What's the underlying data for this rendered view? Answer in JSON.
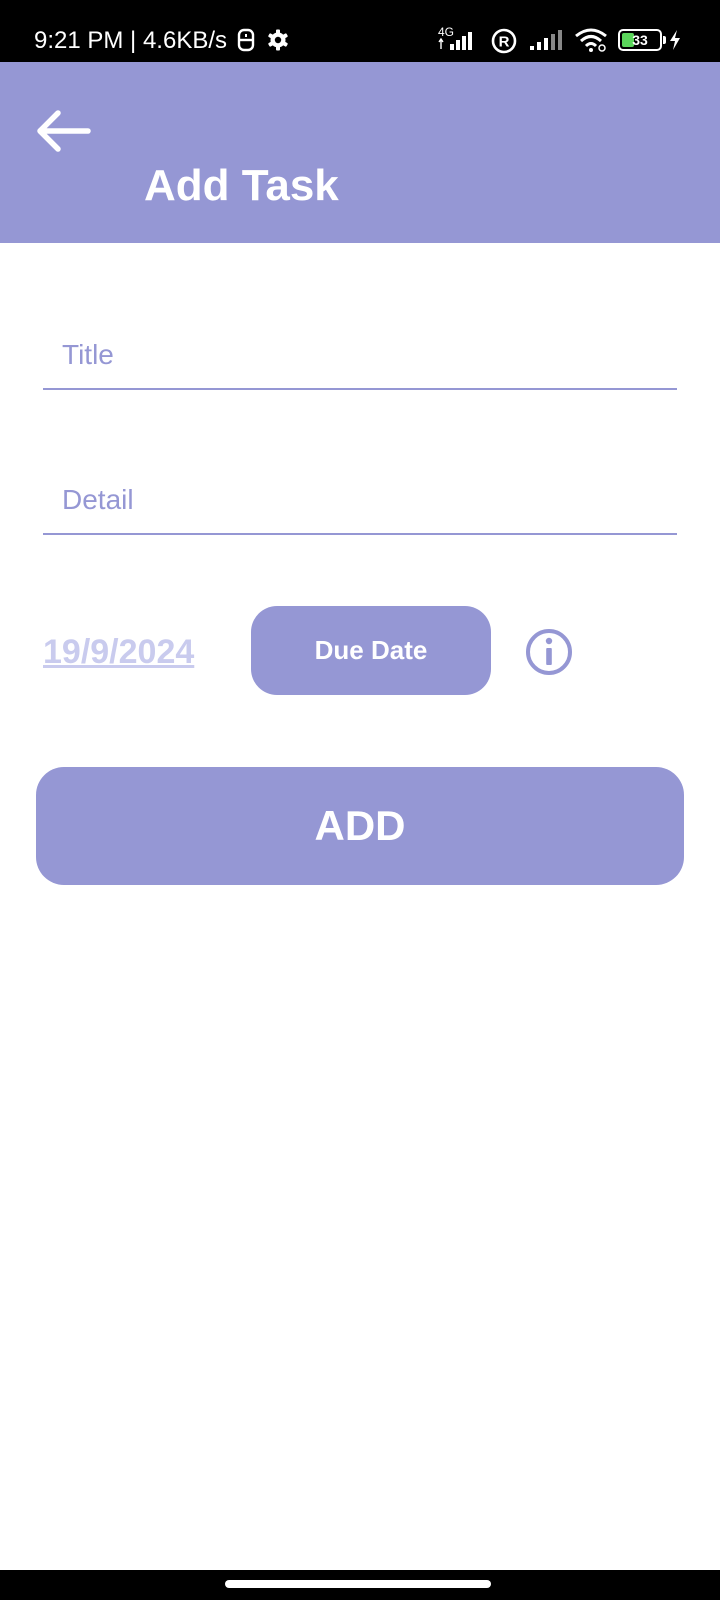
{
  "status_bar": {
    "time": "9:21 PM | 4.6KB/s",
    "network_type": "4G",
    "battery_level": "33",
    "icons": [
      "usb-icon",
      "settings-gear-icon",
      "signal-4g-icon",
      "roaming-r-icon",
      "signal-icon",
      "wifi-icon",
      "battery-icon",
      "charging-bolt-icon"
    ]
  },
  "app_bar": {
    "title": "Add Task",
    "back_icon": "back-arrow-icon"
  },
  "form": {
    "title_placeholder": "Title",
    "title_value": "",
    "detail_placeholder": "Detail",
    "detail_value": "",
    "due_date_value": "19/9/2024",
    "due_date_button_label": "Due Date",
    "info_icon": "info-icon",
    "add_button_label": "ADD"
  },
  "colors": {
    "primary": "#9597d4",
    "date_text": "#c9cbee",
    "background": "#ffffff",
    "status_bar": "#000000"
  }
}
